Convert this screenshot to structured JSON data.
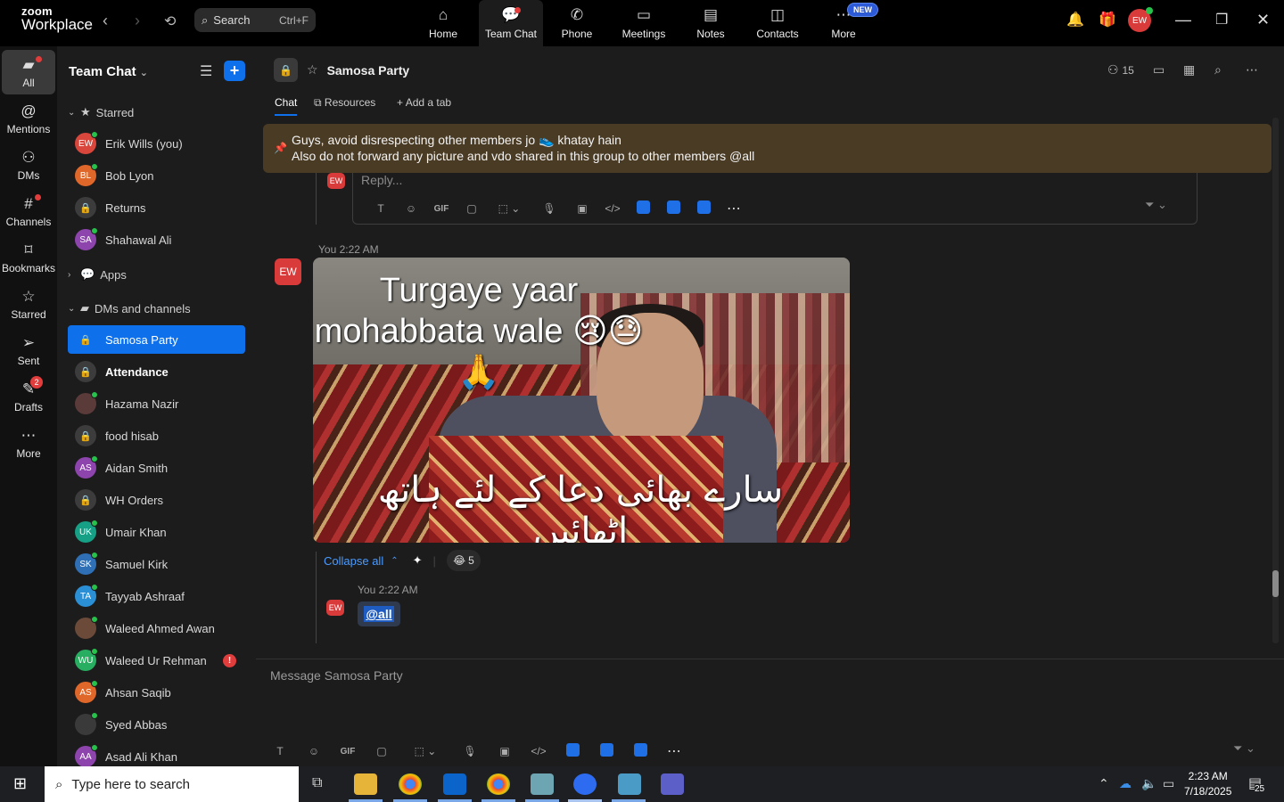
{
  "app": {
    "logo_top": "zoom",
    "logo_bottom": "Workplace"
  },
  "topbar": {
    "search_label": "Search",
    "search_shortcut": "Ctrl+F",
    "tabs": [
      {
        "label": "Home",
        "icon": "home-icon"
      },
      {
        "label": "Team Chat",
        "icon": "chat-icon"
      },
      {
        "label": "Phone",
        "icon": "phone-icon"
      },
      {
        "label": "Meetings",
        "icon": "video-icon"
      },
      {
        "label": "Notes",
        "icon": "notes-icon"
      },
      {
        "label": "Contacts",
        "icon": "contacts-icon"
      },
      {
        "label": "More",
        "icon": "more-icon",
        "badge": "NEW"
      }
    ],
    "avatar": "EW"
  },
  "rail": [
    {
      "label": "All",
      "icon": "chat-bubble-icon"
    },
    {
      "label": "Mentions",
      "icon": "at-icon"
    },
    {
      "label": "DMs",
      "icon": "people-icon"
    },
    {
      "label": "Channels",
      "icon": "hash-icon"
    },
    {
      "label": "Bookmarks",
      "icon": "bookmark-icon"
    },
    {
      "label": "Starred",
      "icon": "star-icon"
    },
    {
      "label": "Sent",
      "icon": "send-icon"
    },
    {
      "label": "Drafts",
      "icon": "draft-icon",
      "count": "2"
    },
    {
      "label": "More",
      "icon": "ellipsis-icon"
    }
  ],
  "sidebar": {
    "title": "Team Chat",
    "starred_label": "Starred",
    "starred": [
      {
        "name": "Erik Wills (you)",
        "initials": "EW",
        "color": "#d9463b",
        "online": true
      },
      {
        "name": "Bob Lyon",
        "initials": "BL",
        "color": "#e0672a",
        "online": true
      },
      {
        "name": "Returns",
        "lock": true
      },
      {
        "name": "Shahawal Ali",
        "initials": "SA",
        "color": "#8e44ad",
        "online": true
      }
    ],
    "apps_label": "Apps",
    "dms_label": "DMs and channels",
    "dms": [
      {
        "name": "Samosa Party",
        "lock": true,
        "active": true
      },
      {
        "name": "Attendance",
        "lock": true,
        "bold": true
      },
      {
        "name": "Hazama Nazir",
        "initials": "",
        "color": "#5b3a3a",
        "online": true
      },
      {
        "name": "food hisab",
        "lock": true
      },
      {
        "name": "Aidan Smith",
        "initials": "AS",
        "color": "#8e44ad",
        "online": true
      },
      {
        "name": "WH Orders",
        "lock": true
      },
      {
        "name": "Umair Khan",
        "initials": "UK",
        "color": "#16a085",
        "online": true
      },
      {
        "name": "Samuel Kirk",
        "initials": "SK",
        "color": "#2f6fb6",
        "online": true
      },
      {
        "name": "Tayyab Ashraaf",
        "initials": "TA",
        "color": "#2b8fd6",
        "online": true
      },
      {
        "name": "Waleed Ahmed Awan",
        "initials": "",
        "color": "#6b4a3a",
        "online": true
      },
      {
        "name": "Waleed Ur Rehman",
        "initials": "WU",
        "color": "#27ae60",
        "online": true,
        "alert": "!"
      },
      {
        "name": "Ahsan Saqib",
        "initials": "AS",
        "color": "#e0672a",
        "online": true
      },
      {
        "name": "Syed Abbas",
        "initials": "",
        "color": "#3a3a3a",
        "online": true
      },
      {
        "name": "Asad Ali Khan",
        "initials": "AA",
        "color": "#8e44ad",
        "online": true
      }
    ]
  },
  "channel": {
    "name": "Samosa Party",
    "members": "15",
    "tabs": [
      "Chat",
      "Resources",
      "Add a tab"
    ],
    "pinned_line1": "Guys, avoid disrespecting other members jo 👟 khatay hain",
    "pinned_line2": "Also do not forward any picture and vdo shared in this group to other members @all",
    "reply_placeholder": "Reply...",
    "message1": {
      "sender_initials": "EW",
      "meta": "You 2:22 AM",
      "image_caption_top": "Turgaye yaar mohabbata wale 😢😓🙏",
      "image_caption_bottom": "سارے بھائی دعا کے لئے ہاتھ اٹھائیں"
    },
    "collapse_label": "Collapse all",
    "reaction_emoji": "😂",
    "reaction_count": "5",
    "message2": {
      "sender_initials": "EW",
      "meta": "You 2:22 AM",
      "text": "@all"
    },
    "composer_placeholder": "Message Samosa Party"
  },
  "taskbar": {
    "search_placeholder": "Type here to search",
    "time": "2:23 AM",
    "date": "7/18/2025",
    "notif_count": "25"
  }
}
